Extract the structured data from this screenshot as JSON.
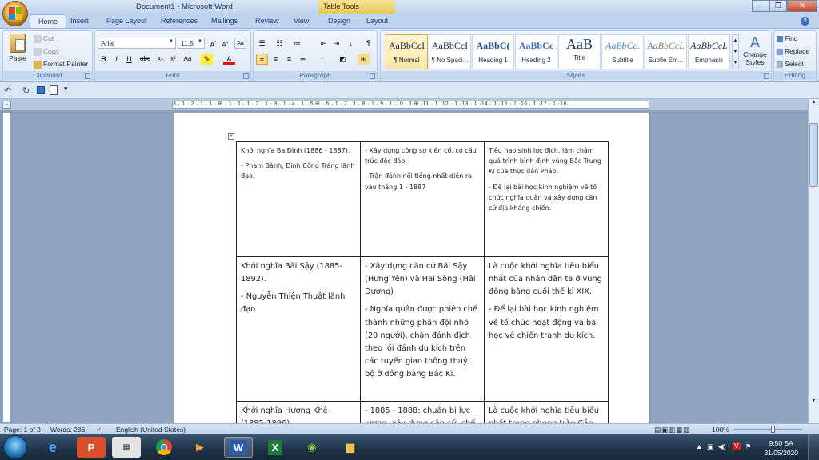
{
  "window": {
    "title": "Document1 - Microsoft Word",
    "contextual_tab_group": "Table Tools"
  },
  "tabs": [
    "Home",
    "Insert",
    "Page Layout",
    "References",
    "Mailings",
    "Review",
    "View",
    "Design",
    "Layout"
  ],
  "ribbon": {
    "clipboard": {
      "paste": "Paste",
      "cut": "Cut",
      "copy": "Copy",
      "format_painter": "Format Painter",
      "label": "Clipboard"
    },
    "font": {
      "name": "Arial",
      "size": "11,5",
      "label": "Font"
    },
    "paragraph": {
      "label": "Paragraph"
    },
    "styles": {
      "label": "Styles",
      "items": [
        {
          "sample": "AaBbCcI",
          "name": "¶ Normal"
        },
        {
          "sample": "AaBbCcI",
          "name": "¶ No Spaci..."
        },
        {
          "sample": "AaBbC(",
          "name": "Heading 1"
        },
        {
          "sample": "AaBbCc",
          "name": "Heading 2"
        },
        {
          "sample": "AaB",
          "name": "Title"
        },
        {
          "sample": "AaBbCc.",
          "name": "Subtitle"
        },
        {
          "sample": "AaBbCcL",
          "name": "Subtle Em..."
        },
        {
          "sample": "AaBbCcL",
          "name": "Emphasis"
        }
      ],
      "change_styles": "Change Styles"
    },
    "editing": {
      "find": "Find",
      "replace": "Replace",
      "select": "Select",
      "label": "Editing"
    }
  },
  "ruler": {
    "ticks": "3 · 1 · 2 · 1 · 1 · ⊞ · 1 · 1 · 1 · 2 · 1 · 3 · 1 · 4 · 1 · 5 ⊞ · 6 · 1 · 7 · 1 · 8 · 1 · 9 · 1 ·10 · 1 ⊞ ·11 · 1 ·12 · 1 ·13 · 1 ·14 · 1 ·15 · 1 ·16 · 1 ·17 · 1 ·18"
  },
  "table": {
    "rows": [
      {
        "col1": [
          "Khởi nghĩa Ba Đình (1886 - 1887).",
          "- Phạm Bành, Đinh Công Tráng lãnh đạo."
        ],
        "col2": [
          "- Xây dựng công sự kiên cố, có cấu trúc độc đáo.",
          "- Trận đánh nổi tiếng nhất diễn ra vào tháng 1 - 1887"
        ],
        "col3": [
          "Tiêu hao sinh lực địch, làm chậm quá trình bình định vùng Bắc Trung Kì của thực dân Pháp.",
          "- Để lại bài học kinh nghiệm về tổ chức nghĩa quân và xây dựng căn cứ địa kháng chiến."
        ]
      },
      {
        "col1": [
          "Khởi nghĩa Bãi Sậy (1885-1892).",
          "- Nguyễn Thiện Thuật lãnh đạo"
        ],
        "col2": [
          "- Xây dựng căn cứ Bãi Sậy (Hưng Yên) và Hai Sông (Hải Dương)",
          "- Nghĩa quân được phiên chế thành những phân đội nhỏ (20 người), chặn đánh địch theo lối đánh du kích trên các tuyến giao thông thuỷ, bộ ở đồng bằng Bắc Kì."
        ],
        "col3": [
          "Là cuộc khởi nghĩa tiêu biểu nhất của nhân dân ta ở vùng đồng bằng cuối thế kỉ XIX.",
          "- Để lại bài học kinh nghiệm về tổ chức hoạt động và bài học về chiến tranh du kích."
        ]
      },
      {
        "col1": [
          "Khởi nghĩa Hương Khê (1885-1896)."
        ],
        "col2": [
          "- 1885 - 1888: chuẩn bị lực lượng, xây dựng căn cứ, chế"
        ],
        "col3": [
          "Là cuộc khởi nghĩa tiêu biểu nhất trong phong trào Cần"
        ]
      }
    ]
  },
  "status": {
    "page": "Page: 1 of 2",
    "words": "Words: 286",
    "language": "English (United States)",
    "zoom": "100%"
  },
  "taskbar": {
    "time": "9:50 SA",
    "date": "31/05/2020"
  }
}
